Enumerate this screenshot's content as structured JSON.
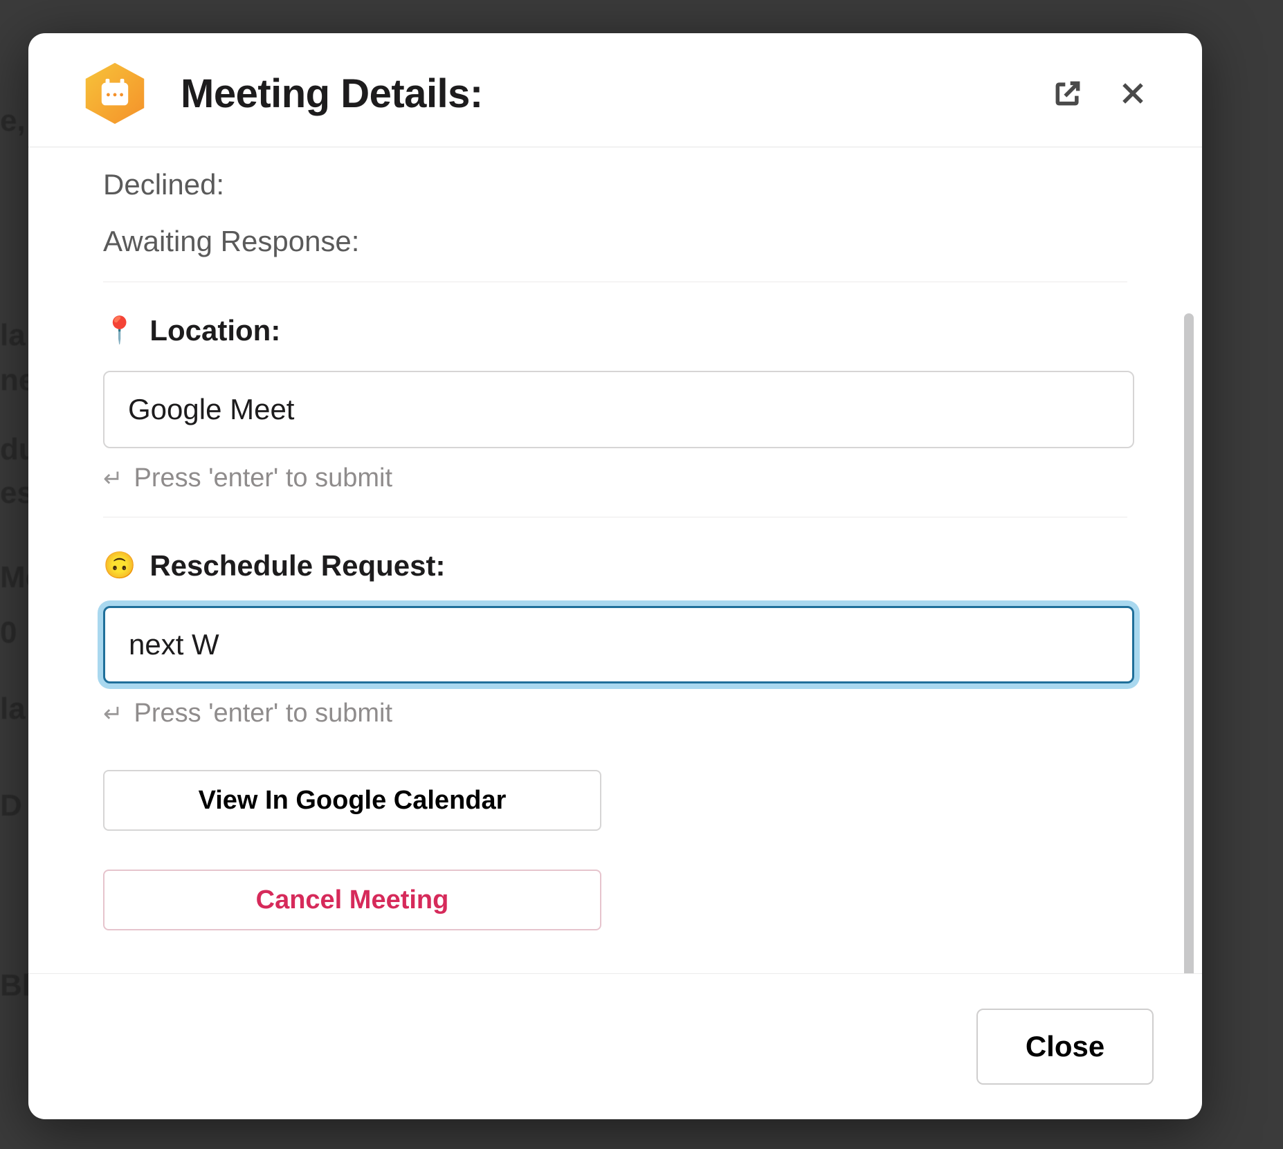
{
  "background": {
    "fragments": [
      "e,",
      "la",
      "ne",
      "du",
      "es",
      "Mo",
      "0",
      "la",
      "D",
      "Bl"
    ]
  },
  "modal": {
    "title": "Meeting Details:",
    "status": {
      "declined_label": "Declined:",
      "awaiting_label": "Awaiting Response:"
    },
    "location": {
      "icon": "📍",
      "label": "Location:",
      "value": "Google Meet",
      "hint": "Press 'enter' to submit"
    },
    "reschedule": {
      "icon": "🙃",
      "label": "Reschedule Request:",
      "value": "next W",
      "hint": "Press 'enter' to submit"
    },
    "actions": {
      "view_calendar": "View In Google Calendar",
      "cancel_meeting": "Cancel Meeting"
    },
    "footer": {
      "close": "Close"
    }
  }
}
